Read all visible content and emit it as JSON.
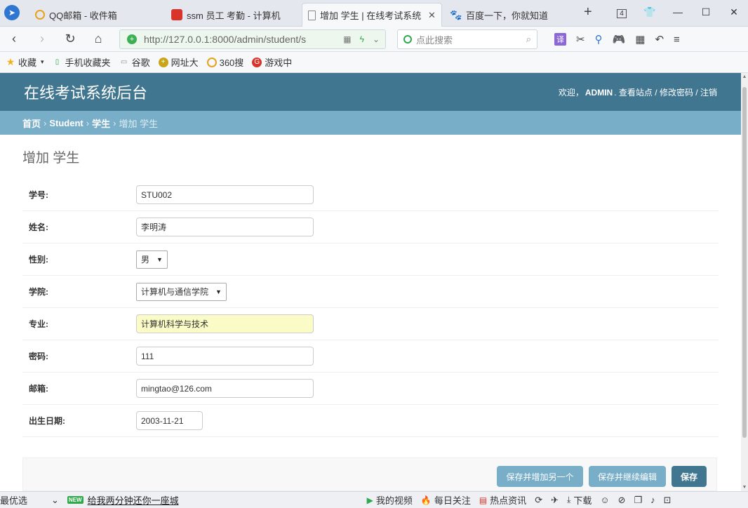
{
  "browser": {
    "tabs": [
      {
        "label": "QQ邮箱 - 收件箱",
        "icon": "qq-mail-icon"
      },
      {
        "label": "ssm 员工 考勤 - 计算机",
        "icon": "page-icon"
      },
      {
        "label": "增加 学生 | 在线考试系统",
        "icon": "document-icon"
      },
      {
        "label": "百度一下，你就知道",
        "icon": "baidu-icon"
      }
    ],
    "tab_count": "4",
    "url": "http://127.0.0.1:8000/admin/student/s",
    "search_placeholder": "点此搜索",
    "translate_label": "译",
    "bookmarks": [
      "收藏",
      "手机收藏夹",
      "谷歌",
      "网址大",
      "360搜",
      "游戏中"
    ]
  },
  "header": {
    "site_title": "在线考试系统后台",
    "welcome": "欢迎，",
    "username": "ADMIN",
    "view_site": "查看站点",
    "change_password": "修改密码",
    "logout": "注销",
    "sep": "/"
  },
  "breadcrumbs": {
    "home": "首页",
    "app": "Student",
    "model": "学生",
    "current": "增加 学生"
  },
  "page_title": "增加 学生",
  "form": {
    "student_id": {
      "label": "学号:",
      "value": "STU002"
    },
    "name": {
      "label": "姓名:",
      "value": "李明涛"
    },
    "gender": {
      "label": "性别:",
      "value": "男"
    },
    "college": {
      "label": "学院:",
      "value": "计算机与通信学院"
    },
    "major": {
      "label": "专业:",
      "value": "计算机科学与技术"
    },
    "password": {
      "label": "密码:",
      "value": "111"
    },
    "email": {
      "label": "邮箱:",
      "value": "mingtao@126.com"
    },
    "birth_date": {
      "label": "出生日期:",
      "value": "2003-11-21"
    }
  },
  "submit": {
    "save_add_another": "保存并增加另一个",
    "save_continue": "保存并继续编辑",
    "save": "保存"
  },
  "statusbar": {
    "left": "最优选",
    "new_badge": "NEW",
    "promo": "给我两分钟还你一座城",
    "video": "我的视频",
    "daily": "每日关注",
    "hot": "热点资讯",
    "download": "下载"
  },
  "colors": {
    "header": "#417690",
    "breadcrumb": "#79aec8",
    "highlight_field": "#fbfbc7"
  }
}
